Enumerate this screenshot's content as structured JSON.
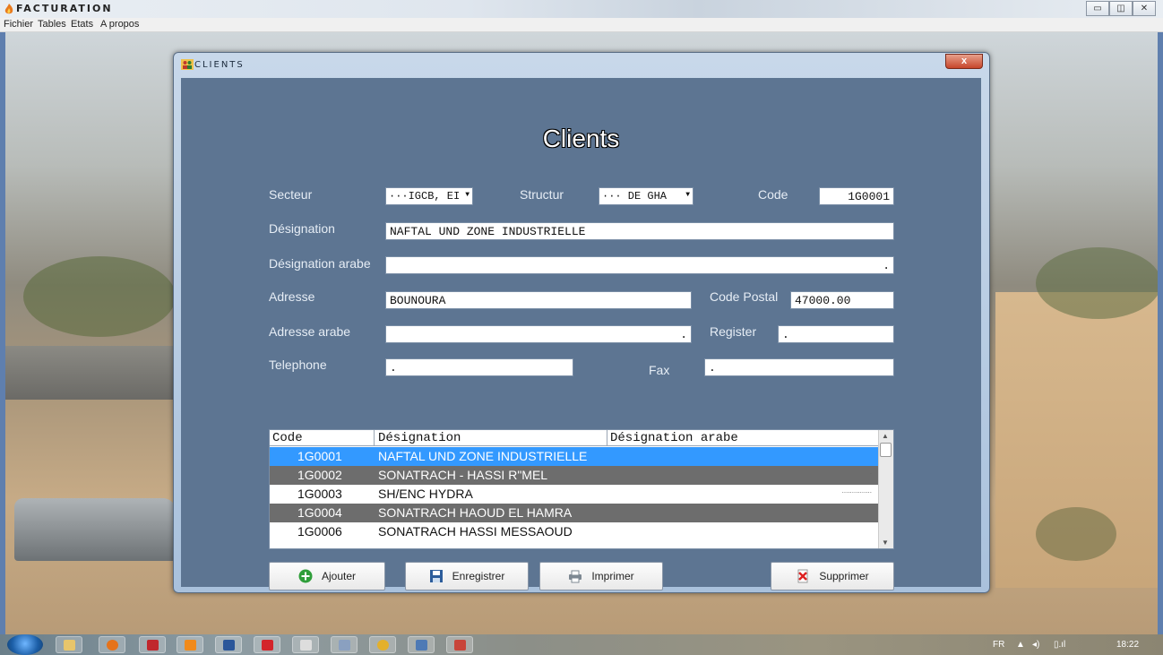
{
  "app": {
    "title": "FACTURATION",
    "window_controls": [
      "▭",
      "◫",
      "✕"
    ]
  },
  "menu": {
    "items": [
      "Fichier",
      "Tables",
      "Etats",
      "A propos"
    ]
  },
  "dialog": {
    "title": "CLIENTS",
    "close_label": "x",
    "heading": "Clients"
  },
  "form": {
    "secteur_label": "Secteur",
    "secteur_value": "···IGCB, EI",
    "structur_label": "Structur",
    "structur_value": "··· DE GHA",
    "code_label": "Code",
    "code_value": "1G0001",
    "designation_label": "Désignation",
    "designation_value": "NAFTAL UND ZONE INDUSTRIELLE",
    "designation_arabe_label": "Désignation arabe",
    "designation_arabe_value": ".",
    "adresse_label": "Adresse",
    "adresse_value": "BOUNOURA",
    "code_postal_label": "Code Postal",
    "code_postal_value": "47000.00",
    "adresse_arabe_label": "Adresse arabe",
    "adresse_arabe_value": ".",
    "register_label": "Register",
    "register_value": ".",
    "telephone_label": "Telephone",
    "telephone_value": ".",
    "fax_label": "Fax",
    "fax_value": "."
  },
  "grid": {
    "columns": [
      "Code",
      "Désignation",
      "Désignation arabe"
    ],
    "rows": [
      {
        "code": "1G0001",
        "designation": "NAFTAL UND ZONE INDUSTRIELLE",
        "arabe": "",
        "state": "selected"
      },
      {
        "code": "1G0002",
        "designation": "SONATRACH - HASSI R\"MEL",
        "arabe": ".",
        "state": "dark"
      },
      {
        "code": "1G0003",
        "designation": "SH/ENC HYDRA",
        "arabe": "...............",
        "state": "light"
      },
      {
        "code": "1G0004",
        "designation": "SONATRACH HAOUD EL HAMRA",
        "arabe": "",
        "state": "dark"
      },
      {
        "code": "1G0006",
        "designation": "SONATRACH HASSI MESSAOUD",
        "arabe": "",
        "state": "light"
      }
    ],
    "row_colors": {
      "selected": "#3399ff",
      "dark": "#6d6d6d",
      "light": "#ffffff"
    }
  },
  "buttons": {
    "ajouter": "Ajouter",
    "enregistrer": "Enregistrer",
    "imprimer": "Imprimer",
    "supprimer": "Supprimer"
  },
  "taskbar": {
    "language": "FR",
    "clock": "18:22"
  }
}
